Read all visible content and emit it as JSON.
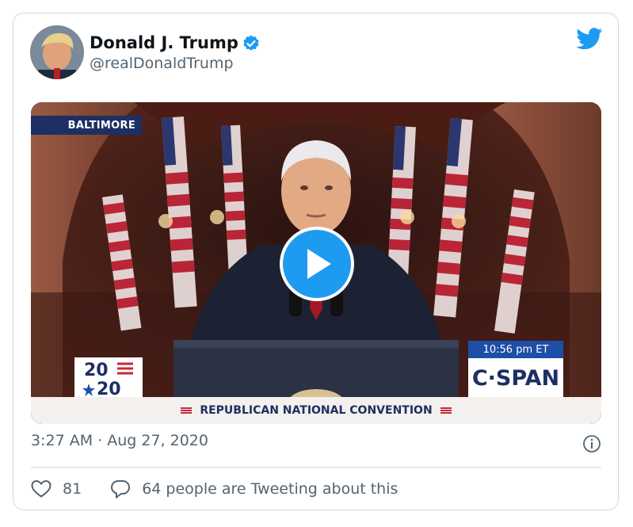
{
  "author": {
    "name": "Donald J. Trump",
    "handle": "@realDonaldTrump",
    "verified": true
  },
  "media": {
    "location_label": "BALTIMORE",
    "time_label": "10:56 pm ET",
    "network_label": "C·SPAN",
    "logo_top": "20",
    "logo_bottom": "20",
    "banner_text": "REPUBLICAN NATIONAL CONVENTION"
  },
  "timestamp": "3:27 AM · Aug 27, 2020",
  "actions": {
    "likes": "81",
    "conversation": "64 people are Tweeting about this"
  },
  "colors": {
    "accent": "#1d9bf0",
    "text_secondary": "#536471",
    "like_red": "#f91880",
    "navy": "#1d2f63"
  },
  "icons": [
    "verified-badge-icon",
    "twitter-bird-icon",
    "play-icon",
    "info-icon",
    "heart-icon",
    "reply-bubble-icon"
  ]
}
